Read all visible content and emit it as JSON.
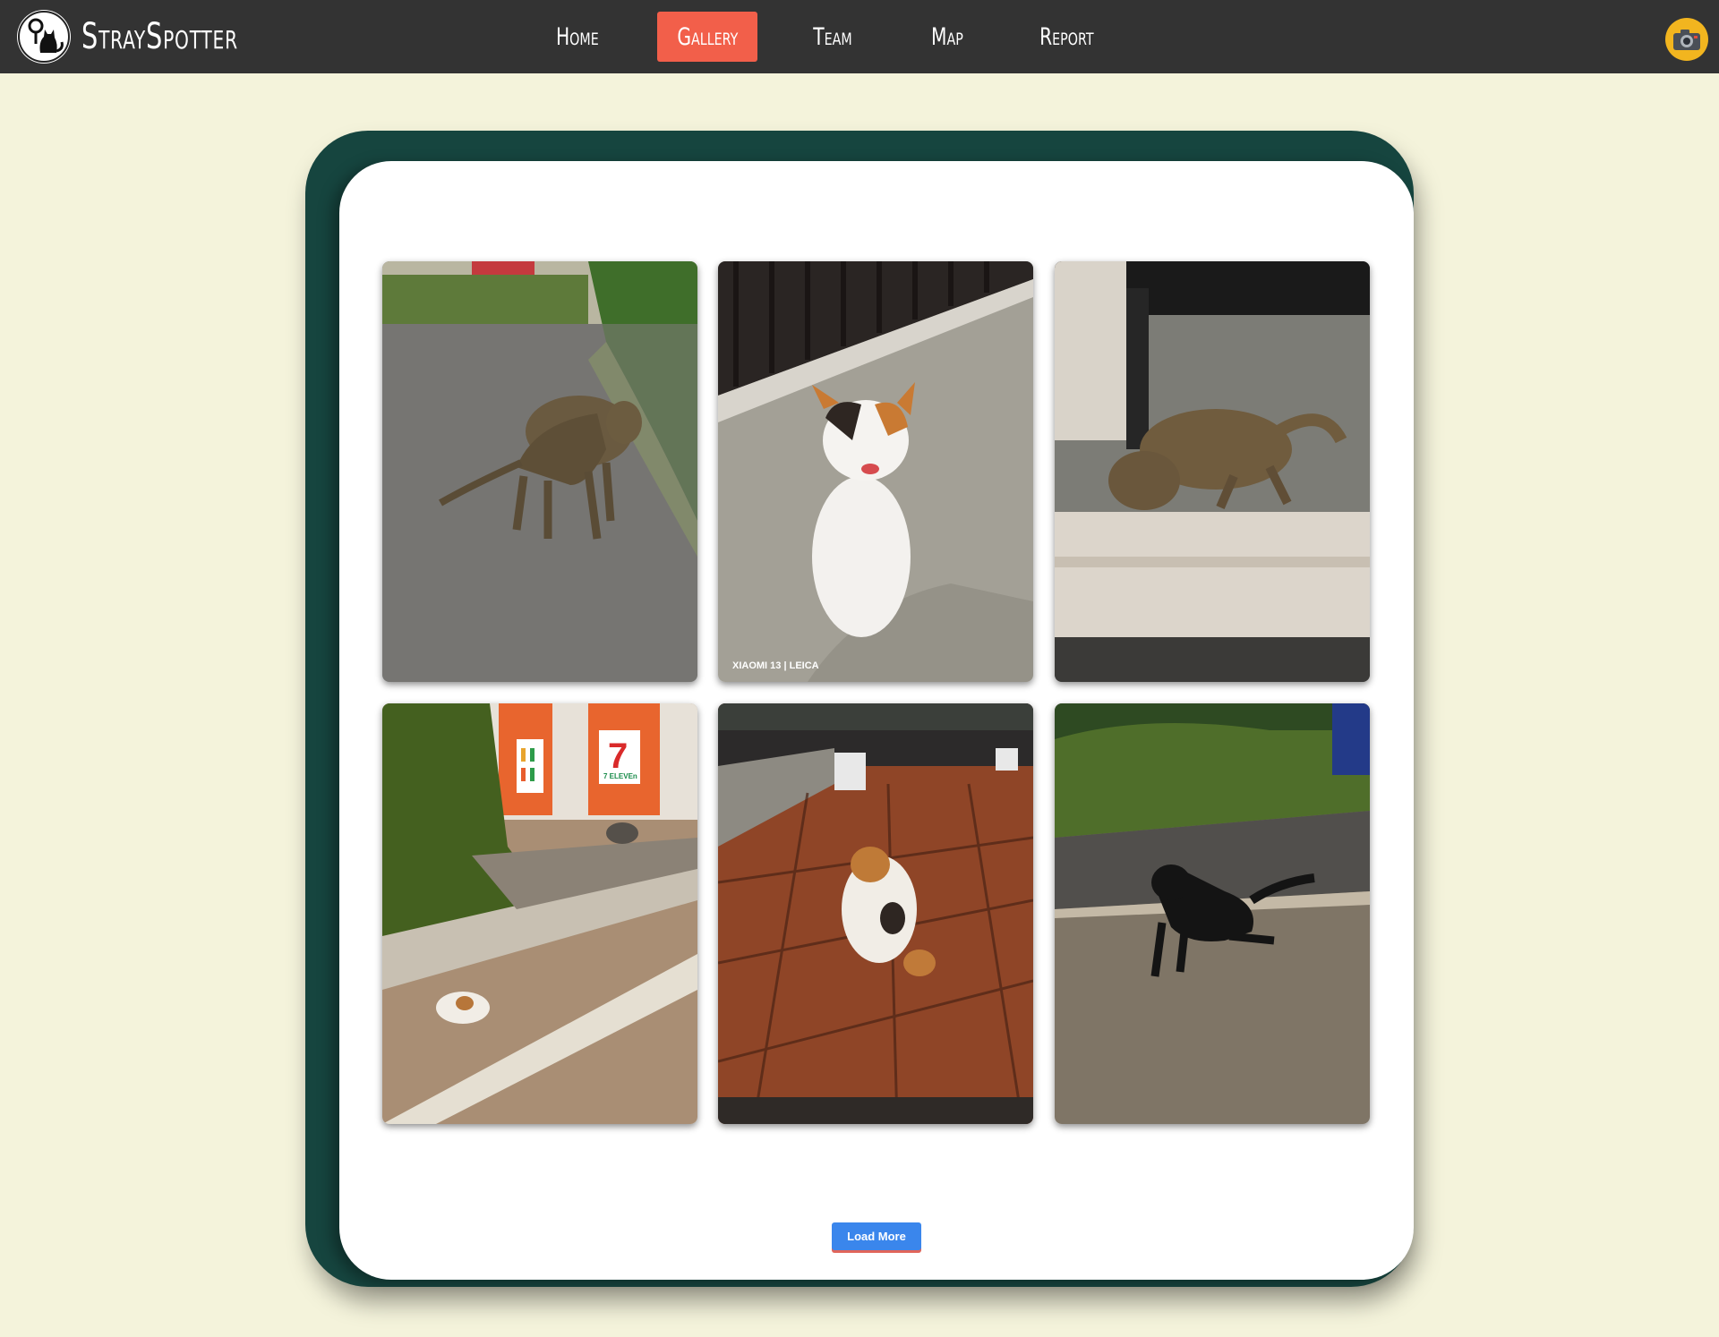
{
  "brand": {
    "name": "StraySpotter",
    "logo_icon": "cat-location-icon"
  },
  "nav": {
    "items": [
      {
        "label": "Home",
        "active": false
      },
      {
        "label": "Gallery",
        "active": true
      },
      {
        "label": "Team",
        "active": false
      },
      {
        "label": "Map",
        "active": false
      },
      {
        "label": "Report",
        "active": false
      }
    ],
    "camera_icon": "camera-icon",
    "active_color": "#f25f4a"
  },
  "gallery": {
    "photos": [
      {
        "subject": "tabby-cat-on-road"
      },
      {
        "subject": "calico-cat-sitting",
        "watermark": "XIAOMI 13 | LEICA"
      },
      {
        "subject": "cat-under-truck"
      },
      {
        "subject": "cats-outside-store",
        "store_sign": "7 ELEVEn"
      },
      {
        "subject": "calico-cat-on-tiles"
      },
      {
        "subject": "black-cat-on-path"
      }
    ],
    "load_more_label": "Load More"
  },
  "colors": {
    "background": "#f4f3db",
    "navbar": "#333333",
    "card_border": "#16453f",
    "button": "#3a86ec"
  }
}
